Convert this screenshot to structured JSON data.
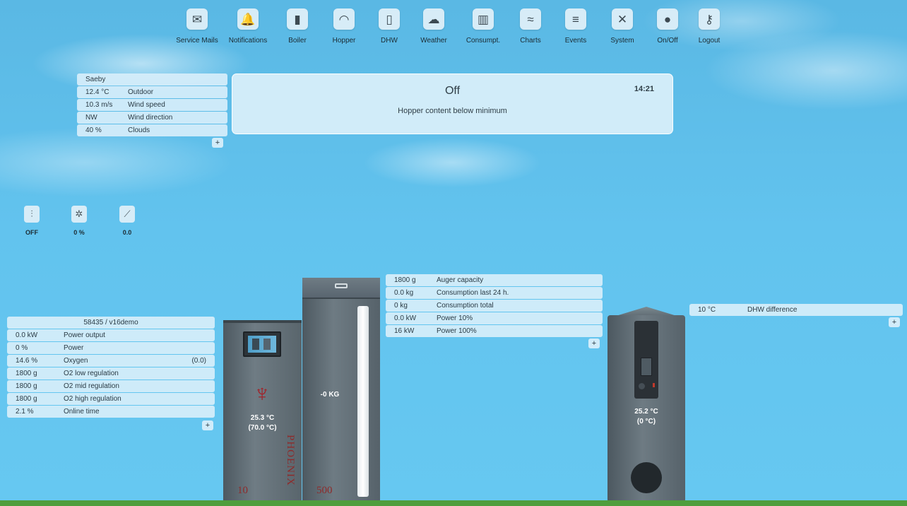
{
  "nav": [
    {
      "label": "Service Mails",
      "icon": "mail-icon",
      "glyph": "✉"
    },
    {
      "label": "Notifications",
      "icon": "bell-icon",
      "glyph": "🔔"
    },
    {
      "label": "Boiler",
      "icon": "boiler-icon",
      "glyph": "▮"
    },
    {
      "label": "Hopper",
      "icon": "gauge-icon",
      "glyph": "◠"
    },
    {
      "label": "DHW",
      "icon": "tank-icon",
      "glyph": "▯"
    },
    {
      "label": "Weather",
      "icon": "cloud-icon",
      "glyph": "☁"
    },
    {
      "label": "Consumpt.",
      "icon": "bar-chart-icon",
      "glyph": "▥"
    },
    {
      "label": "Charts",
      "icon": "line-chart-icon",
      "glyph": "≈"
    },
    {
      "label": "Events",
      "icon": "list-icon",
      "glyph": "≡"
    },
    {
      "label": "System",
      "icon": "tools-icon",
      "glyph": "✕"
    },
    {
      "label": "On/Off",
      "icon": "power-icon",
      "glyph": "●"
    },
    {
      "label": "Logout",
      "icon": "key-icon",
      "glyph": "⚷"
    }
  ],
  "weather": {
    "location": "Saeby",
    "rows": [
      {
        "value": "12.4 °C",
        "label": "Outdoor"
      },
      {
        "value": "10.3 m/s",
        "label": "Wind speed"
      },
      {
        "value": "NW",
        "label": "Wind direction"
      },
      {
        "value": "40 %",
        "label": "Clouds"
      }
    ]
  },
  "status": {
    "title": "Off",
    "message": "Hopper content below minimum",
    "time": "14:21"
  },
  "indicators": [
    {
      "icon": "thermostat-icon",
      "glyph": "⫶",
      "value": "OFF"
    },
    {
      "icon": "fan-icon",
      "glyph": "✲",
      "value": "0 %"
    },
    {
      "icon": "sweeper-icon",
      "glyph": "⟋",
      "value": "0.0"
    }
  ],
  "boiler_table": {
    "header": "58435 / v16demo",
    "rows": [
      {
        "value": "0.0 kW",
        "label": "Power output",
        "extra": ""
      },
      {
        "value": "0 %",
        "label": "Power",
        "extra": ""
      },
      {
        "value": "14.6 %",
        "label": "Oxygen",
        "extra": "(0.0)"
      },
      {
        "value": "1800 g",
        "label": "O2 low regulation",
        "extra": ""
      },
      {
        "value": "1800 g",
        "label": "O2 mid regulation",
        "extra": ""
      },
      {
        "value": "1800 g",
        "label": "O2 high regulation",
        "extra": ""
      },
      {
        "value": "2.1 %",
        "label": "Online time",
        "extra": ""
      }
    ]
  },
  "hopper_table": {
    "rows": [
      {
        "value": "1800 g",
        "label": "Auger capacity"
      },
      {
        "value": "0.0 kg",
        "label": "Consumption last 24 h."
      },
      {
        "value": "0 kg",
        "label": "Consumption total"
      },
      {
        "value": "0.0 kW",
        "label": "Power 10%"
      },
      {
        "value": "16 kW",
        "label": "Power 100%"
      }
    ]
  },
  "dhw_table": {
    "rows": [
      {
        "value": "10 °C",
        "label": "DHW difference"
      }
    ]
  },
  "boiler": {
    "temp": "25.3 °C",
    "setpoint": "(70.0 °C)",
    "brand": "PHOENIX",
    "size": "10"
  },
  "hopper": {
    "weight": "-0 KG",
    "size": "500"
  },
  "dhw": {
    "temp": "25.2 °C",
    "setpoint": "(0 °C)"
  },
  "plus_label": "+",
  "colors": {
    "sky": "#62c3ee",
    "ground": "#4f9e3d",
    "panel": "#d7ecf7",
    "brand_red": "#8e2a2a"
  }
}
